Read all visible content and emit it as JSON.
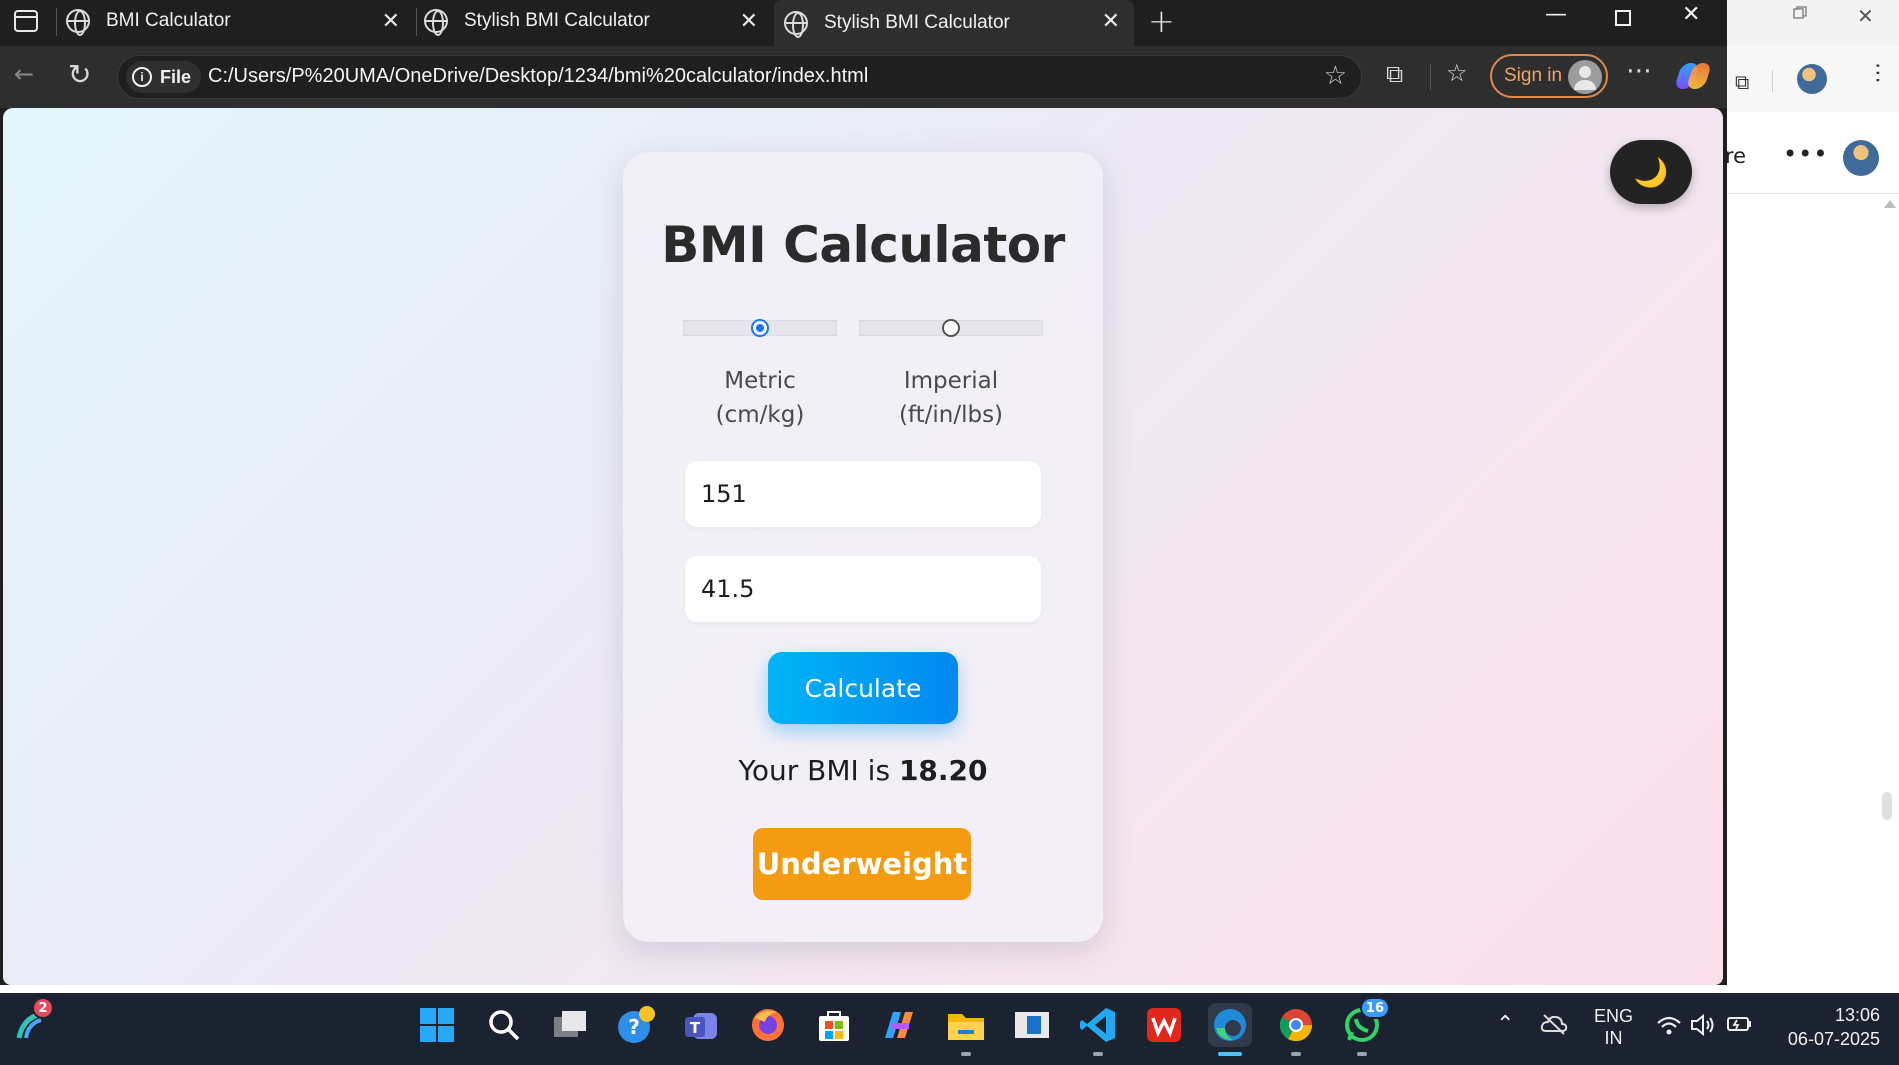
{
  "browser": {
    "tabs": [
      {
        "title": "BMI Calculator",
        "active": false
      },
      {
        "title": "Stylish BMI Calculator",
        "active": false
      },
      {
        "title": "Stylish BMI Calculator",
        "active": true
      }
    ],
    "file_chip": "File",
    "url": "C:/Users/P%20UMA/OneDrive/Desktop/1234/bmi%20calculator/index.html",
    "sign_in": "Sign in"
  },
  "background_window": {
    "partial_text": "re"
  },
  "page": {
    "dark_mode_icon": "🌙",
    "title": "BMI Calculator",
    "units": [
      {
        "label": "Metric",
        "sub": "(cm/kg)",
        "checked": true
      },
      {
        "label": "Imperial",
        "sub": "(ft/in/lbs)",
        "checked": false
      }
    ],
    "height_value": "151",
    "weight_value": "41.5",
    "calculate_label": "Calculate",
    "result_prefix": "Your BMI is",
    "result_value": "18.20",
    "category": "Underweight",
    "colors": {
      "accent": "#0288f0",
      "category_bg": "#f39c12",
      "radio_checked": "#1a73e8"
    }
  },
  "taskbar": {
    "widgets_badge": "2",
    "whatsapp_badge": "16",
    "language": "ENG",
    "region": "IN",
    "time": "13:06",
    "date": "06-07-2025"
  }
}
